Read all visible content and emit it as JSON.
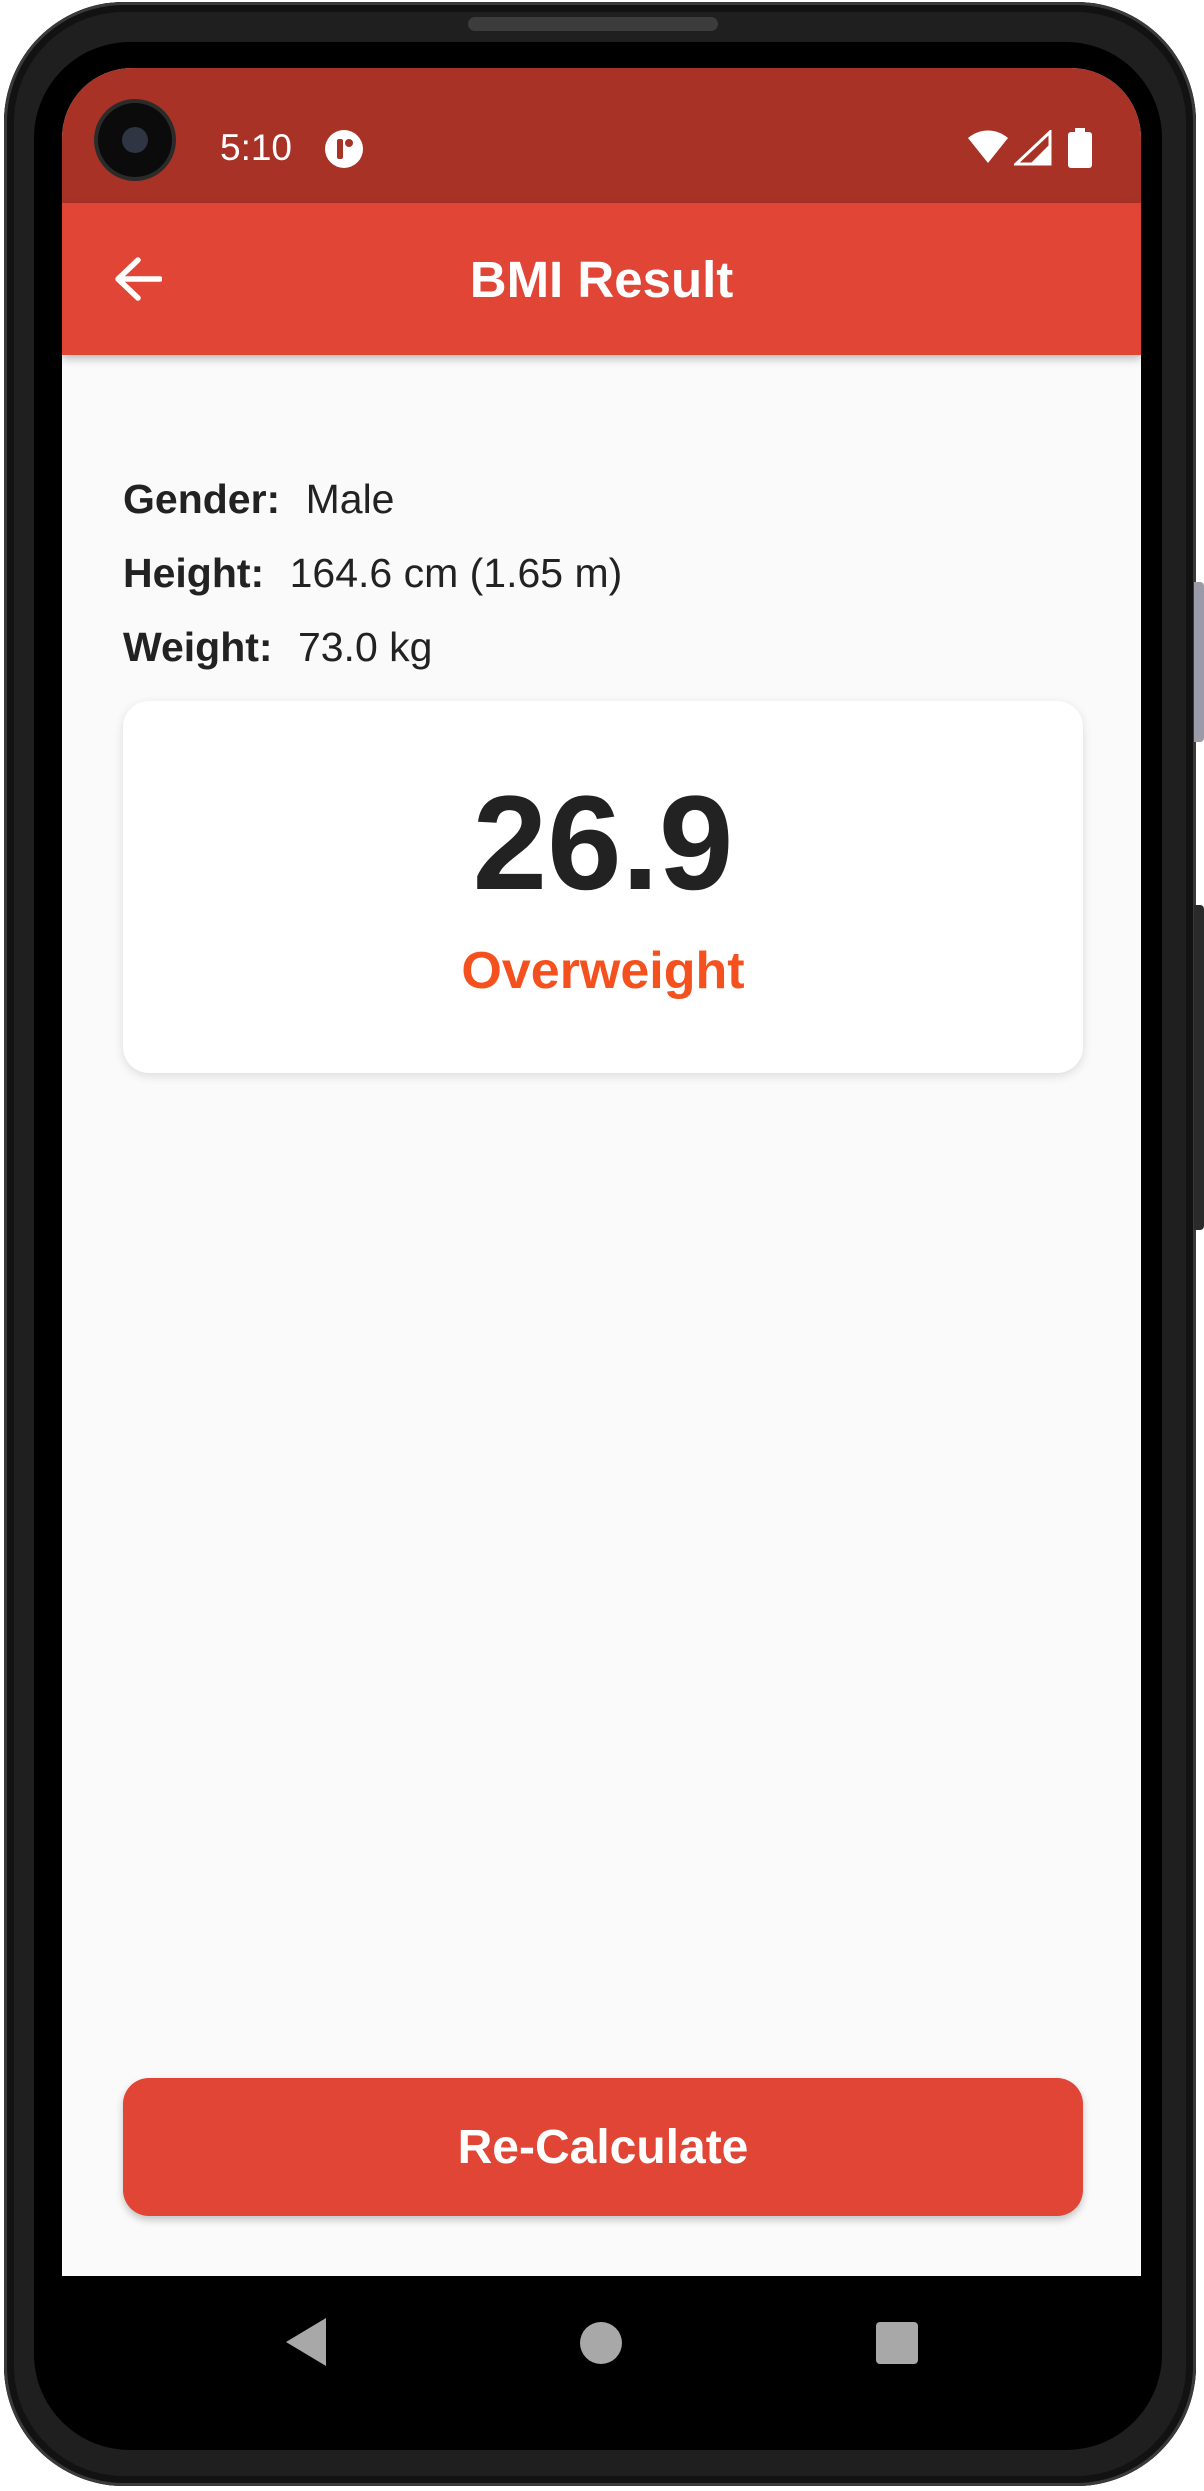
{
  "status_bar": {
    "time": "5:10",
    "icons": [
      "wifi-icon",
      "signal-icon",
      "battery-icon"
    ],
    "color": "#a93226"
  },
  "app_bar": {
    "title": "BMI Result",
    "back_icon": "arrow-left-icon",
    "color": "#e04536"
  },
  "details": [
    {
      "label": "Gender:",
      "value": "Male"
    },
    {
      "label": "Height:",
      "value": "164.6 cm (1.65 m)"
    },
    {
      "label": "Weight:",
      "value": "73.0 kg"
    }
  ],
  "result": {
    "bmi": "26.9",
    "category": "Overweight",
    "category_color": "#f4511e"
  },
  "actions": {
    "recalculate_label": "Re-Calculate"
  },
  "nav_bar": {
    "icons": [
      "nav-back-icon",
      "nav-home-icon",
      "nav-recents-icon"
    ]
  }
}
